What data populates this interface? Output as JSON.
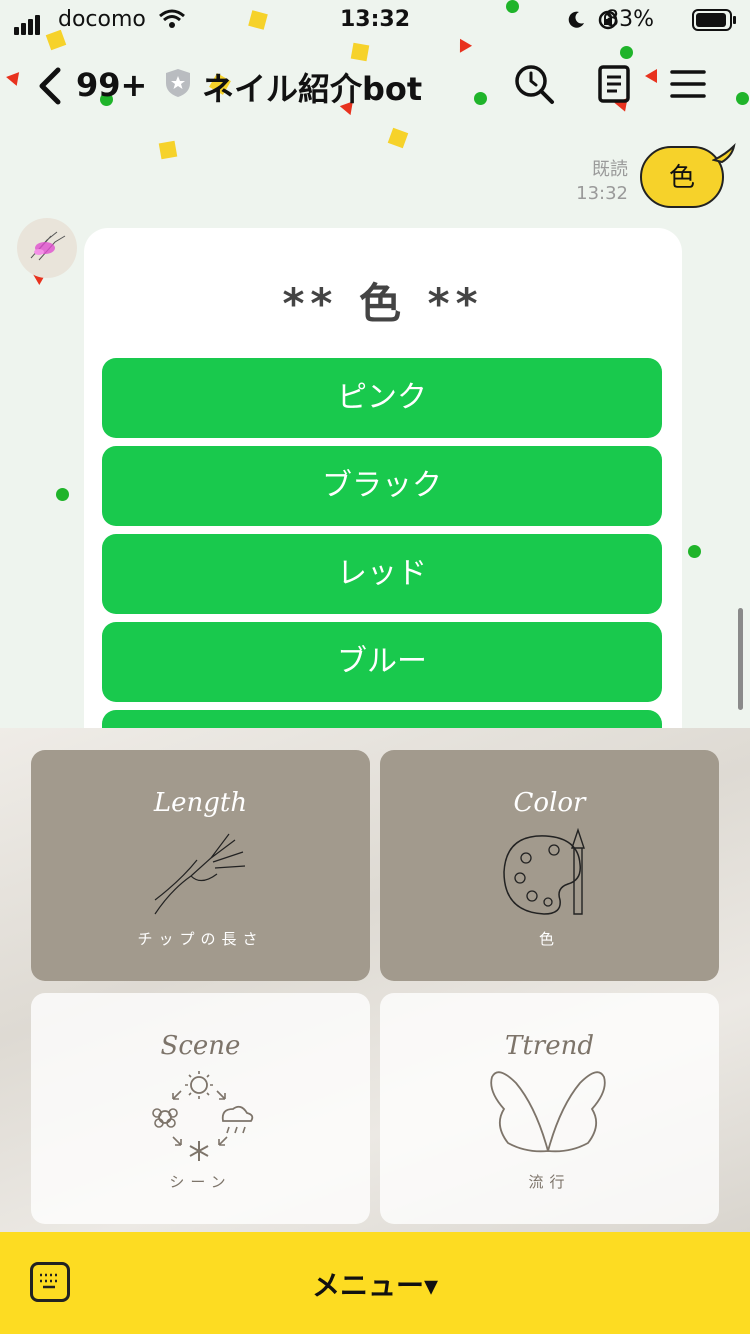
{
  "status_bar": {
    "carrier": "docomo",
    "time": "13:32",
    "battery": "83%"
  },
  "header": {
    "back_count": "99+",
    "title": "ネイル紹介bot"
  },
  "messages": {
    "sent_text": "色",
    "read_label": "既読",
    "read_time": "13:32"
  },
  "card": {
    "title": "** 色 **",
    "options": [
      "ピンク",
      "ブラック",
      "レッド",
      "ブルー"
    ]
  },
  "rich_menu": {
    "tiles": [
      {
        "en": "Length",
        "jp": "チップの長さ"
      },
      {
        "en": "Color",
        "jp": "色"
      },
      {
        "en": "Scene",
        "jp": "シーン"
      },
      {
        "en": "Ttrend",
        "jp": "流行"
      }
    ]
  },
  "bottom_bar": {
    "label": "メニュー▾"
  },
  "colors": {
    "button_green": "#19c94d",
    "bubble_yellow": "#f6d22a",
    "bar_yellow": "#fddc22",
    "tile_brown": "#a29a8d"
  }
}
